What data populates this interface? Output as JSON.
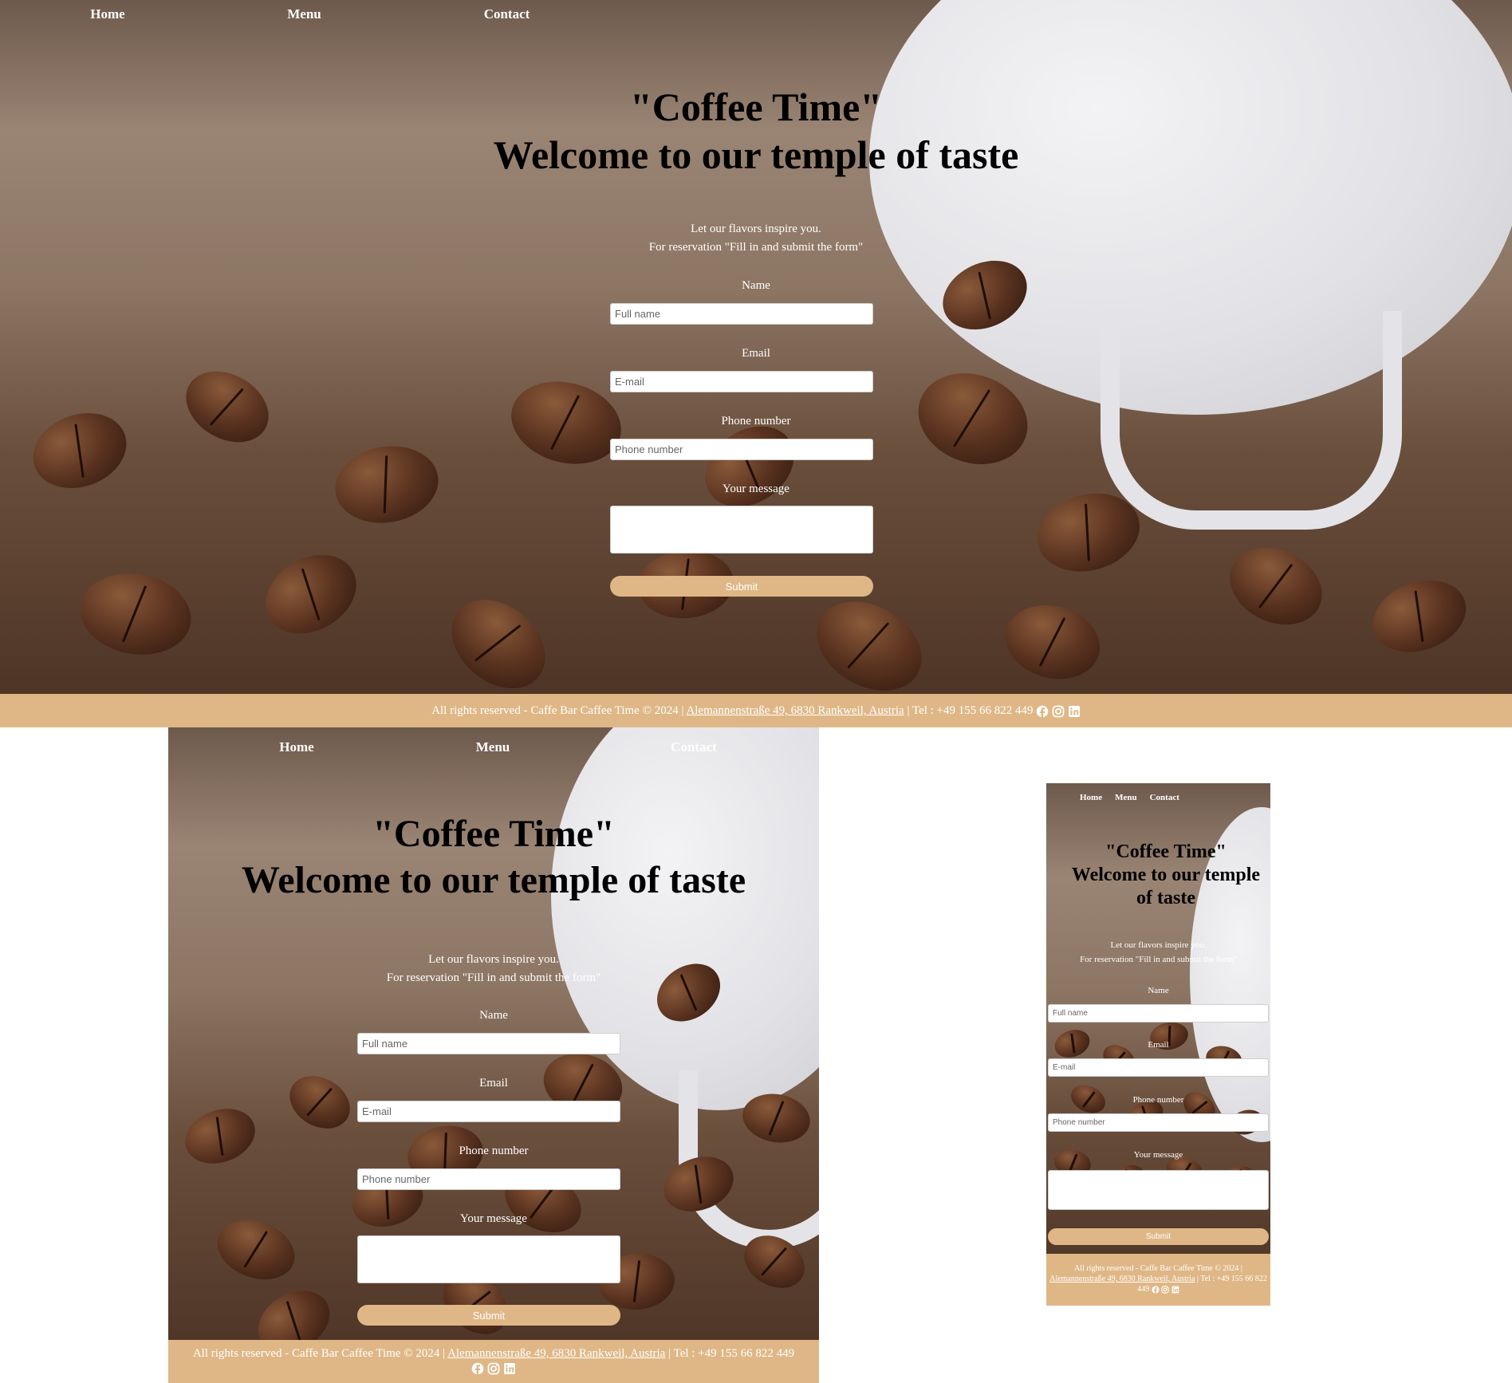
{
  "nav": {
    "home": "Home",
    "menu": "Menu",
    "contact": "Contact"
  },
  "hero": {
    "line1": "\"Coffee Time\"",
    "line2": "Welcome to our temple of taste"
  },
  "intro": {
    "line1": "Let our flavors inspire you.",
    "line2": "For reservation \"Fill in and submit the form\""
  },
  "form": {
    "name_label": "Name",
    "name_placeholder": "Full name",
    "email_label": "Email",
    "email_placeholder": "E-mail",
    "phone_label": "Phone number",
    "phone_placeholder": "Phone number",
    "message_label": "Your message",
    "submit_label": "Submit"
  },
  "footer": {
    "prefix": "All rights reserved - Caffe Bar Caffee Time © 2024 |",
    "address": "Alemannenstraße 49, 6830 Rankweil, Austria",
    "tel": "| Tel : +49 155 66 822 449"
  },
  "icons": [
    "facebook-icon",
    "instagram-icon",
    "linkedin-icon"
  ],
  "colors": {
    "accent": "#dfb786",
    "heading": "#000000",
    "text": "#ffffff"
  }
}
